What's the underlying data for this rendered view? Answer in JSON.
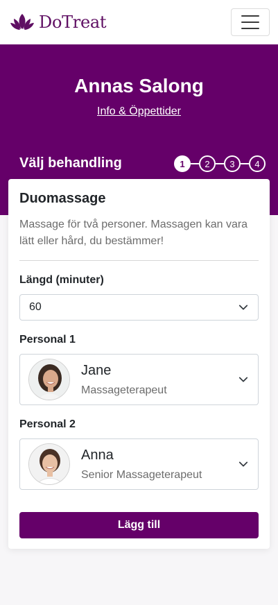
{
  "header": {
    "brand": "DoTreat",
    "menu_icon": "hamburger-menu-icon"
  },
  "salon": {
    "name": "Annas Salong",
    "info_link": "Info & Öppettider"
  },
  "steps": {
    "title": "Välj behandling",
    "items": [
      "1",
      "2",
      "3",
      "4"
    ],
    "current": 1
  },
  "treatment": {
    "title": "Duomassage",
    "description": "Massage för två personer. Massagen kan vara lätt eller hård, du bestämmer!",
    "length_label": "Längd (minuter)",
    "length_value": "60",
    "staff1_label": "Personal 1",
    "staff1": {
      "name": "Jane",
      "role": "Massageterapeut"
    },
    "staff2_label": "Personal 2",
    "staff2": {
      "name": "Anna",
      "role": "Senior Massageterapeut"
    },
    "add_button": "Lägg till"
  },
  "colors": {
    "brand": "#650069",
    "logo": "#5f0f63"
  }
}
